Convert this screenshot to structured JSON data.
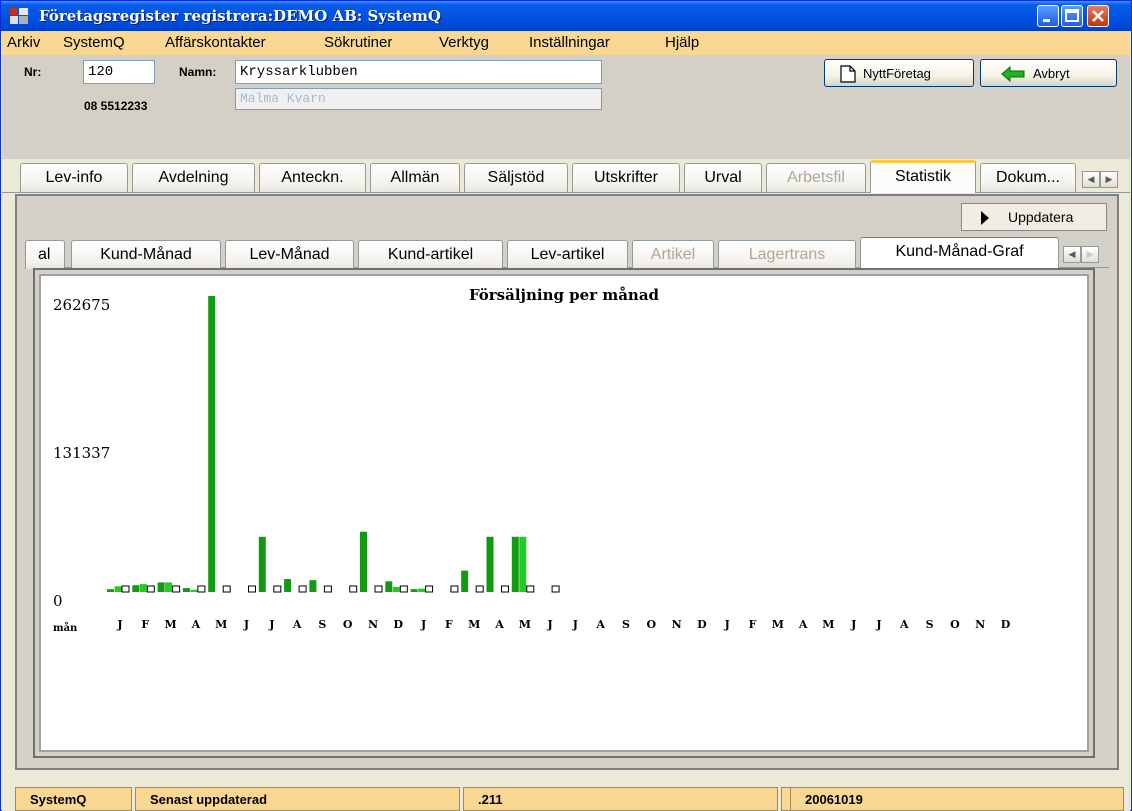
{
  "window": {
    "title": "Företagsregister registrera:DEMO AB: SystemQ"
  },
  "menu": [
    "Arkiv",
    "SystemQ",
    "Affärskontakter",
    "Sökrutiner",
    "Verktyg",
    "Inställningar",
    "Hjälp"
  ],
  "header": {
    "nr_label": "Nr:",
    "nr_value": "120",
    "namn_label": "Namn:",
    "namn_value": "Kryssarklubben",
    "phone": "08 5512233",
    "address": "Malma Kvarn",
    "new_company_button": "NyttFöretag",
    "cancel_button": "Avbryt"
  },
  "main_tabs": [
    {
      "label": "Lev-info",
      "state": "normal"
    },
    {
      "label": "Avdelning",
      "state": "normal"
    },
    {
      "label": "Anteckn.",
      "state": "normal"
    },
    {
      "label": "Allmän",
      "state": "normal"
    },
    {
      "label": "Säljstöd",
      "state": "normal"
    },
    {
      "label": "Utskrifter",
      "state": "normal"
    },
    {
      "label": "Urval",
      "state": "normal"
    },
    {
      "label": "Arbetsfil",
      "state": "disabled"
    },
    {
      "label": "Statistik",
      "state": "active"
    },
    {
      "label": "Dokum...",
      "state": "normal"
    }
  ],
  "update_button": "Uppdatera",
  "sub_tabs": [
    {
      "label": "al",
      "state": "normal"
    },
    {
      "label": "Kund-Månad",
      "state": "normal"
    },
    {
      "label": "Lev-Månad",
      "state": "normal"
    },
    {
      "label": "Kund-artikel",
      "state": "normal"
    },
    {
      "label": "Lev-artikel",
      "state": "normal"
    },
    {
      "label": "Artikel",
      "state": "disabled"
    },
    {
      "label": "Lagertrans",
      "state": "disabled"
    },
    {
      "label": "Kund-Månad-Graf",
      "state": "active"
    }
  ],
  "chart_data": {
    "type": "bar",
    "title": "Försäljning per månad",
    "xlabel": "mån",
    "ylabel": "",
    "ylim": [
      0,
      262675
    ],
    "yticks": [
      "262675",
      "131337",
      "0"
    ],
    "categories": [
      "J",
      "F",
      "M",
      "A",
      "M",
      "J",
      "J",
      "A",
      "S",
      "O",
      "N",
      "D",
      "J",
      "F",
      "M",
      "A",
      "M",
      "J",
      "J",
      "A",
      "S",
      "O",
      "N",
      "D",
      "J",
      "F",
      "M",
      "A",
      "M",
      "J",
      "J",
      "A",
      "S",
      "O",
      "N",
      "D"
    ],
    "series": [
      {
        "name": "",
        "color": "#139A13",
        "values": [
          2500,
          6000,
          8500,
          3500,
          262675,
          0,
          49000,
          11500,
          10500,
          0,
          53500,
          9500,
          2500,
          0,
          19000,
          49000,
          49000,
          0,
          null,
          null,
          null,
          null,
          null,
          null,
          null,
          null,
          null,
          null,
          null,
          null,
          null,
          null,
          null,
          null,
          null,
          null
        ]
      },
      {
        "name": "",
        "color": "#22CC22",
        "values": [
          5000,
          7000,
          8500,
          2000,
          0,
          0,
          0,
          0,
          0,
          0,
          0,
          4500,
          3000,
          0,
          0,
          0,
          49000,
          0,
          null,
          null,
          null,
          null,
          null,
          null,
          null,
          null,
          null,
          null,
          null,
          null,
          null,
          null,
          null,
          null,
          null,
          null
        ]
      },
      {
        "name": "",
        "color": "#FFFFFF",
        "values": [
          0,
          0,
          0,
          0,
          0,
          0,
          0,
          0,
          0,
          0,
          0,
          0,
          0,
          0,
          0,
          0,
          0,
          0,
          null,
          null,
          null,
          null,
          null,
          null,
          null,
          null,
          null,
          null,
          null,
          null,
          null,
          null,
          null,
          null,
          null,
          null
        ]
      }
    ]
  },
  "status": [
    "SystemQ",
    "Senast uppdaterad",
    ".211",
    "",
    "20061019"
  ]
}
